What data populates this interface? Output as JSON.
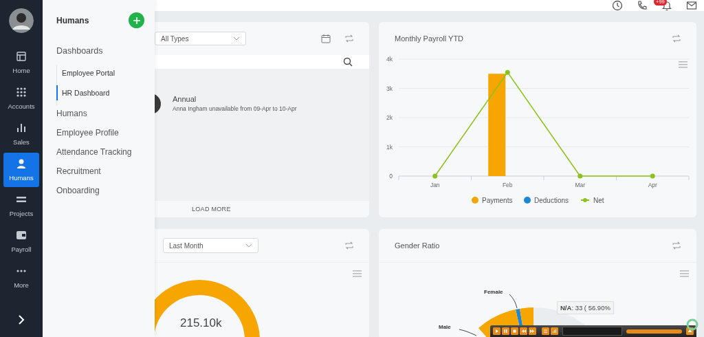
{
  "rail": {
    "items": [
      {
        "label": "Home",
        "selected": false
      },
      {
        "label": "Accounts",
        "selected": false
      },
      {
        "label": "Sales",
        "selected": false
      },
      {
        "label": "Humans",
        "selected": true
      },
      {
        "label": "Projects",
        "selected": false
      },
      {
        "label": "Payroll",
        "selected": false
      },
      {
        "label": "More",
        "selected": false
      }
    ]
  },
  "topbar": {
    "badge": "+99"
  },
  "flyout": {
    "title": "Humans",
    "group": "Dashboards",
    "sub_items": [
      {
        "label": "Employee Portal",
        "selected": false
      },
      {
        "label": "HR Dashboard",
        "selected": true
      }
    ],
    "items": [
      "Humans",
      "Employee Profile",
      "Attendance Tracking",
      "Recruitment",
      "Onboarding"
    ]
  },
  "leave_card": {
    "filter": "All Types",
    "entries": [
      {
        "title": "Annual",
        "text": "Anna Ingham unavailable from 09-Apr to 10-Apr"
      }
    ],
    "load_more": "LOAD MORE"
  },
  "payroll_card": {
    "title": "Monthly Payroll YTD",
    "chart_data": {
      "type": "bar",
      "grid": true,
      "legend": true,
      "categories": [
        "Jan",
        "Feb",
        "Mar",
        "Apr"
      ],
      "ylim": [
        0,
        4000
      ],
      "yticks": [
        {
          "value": 0,
          "label": "0"
        },
        {
          "value": 1000,
          "label": "1k"
        },
        {
          "value": 2000,
          "label": "2k"
        },
        {
          "value": 3000,
          "label": "3k"
        },
        {
          "value": 4000,
          "label": "4k"
        }
      ],
      "series": [
        {
          "name": "Payments",
          "color": "#f7a500",
          "values": [
            0,
            3500,
            0,
            0
          ]
        },
        {
          "name": "Deductions",
          "color": "#1e88d2",
          "values": [
            0,
            0,
            0,
            0
          ]
        },
        {
          "name": "Net",
          "type": "line",
          "marker": "circle",
          "color": "#8cc21f",
          "values": [
            0,
            3550,
            0,
            0
          ]
        }
      ]
    }
  },
  "total_card": {
    "filter": "Last Month",
    "center_value": "215.10k"
  },
  "gender_card": {
    "title": "Gender Ratio",
    "labels": [
      "Female",
      "Male"
    ],
    "tooltip": "**N/A**: 33 ( 56.90%"
  }
}
